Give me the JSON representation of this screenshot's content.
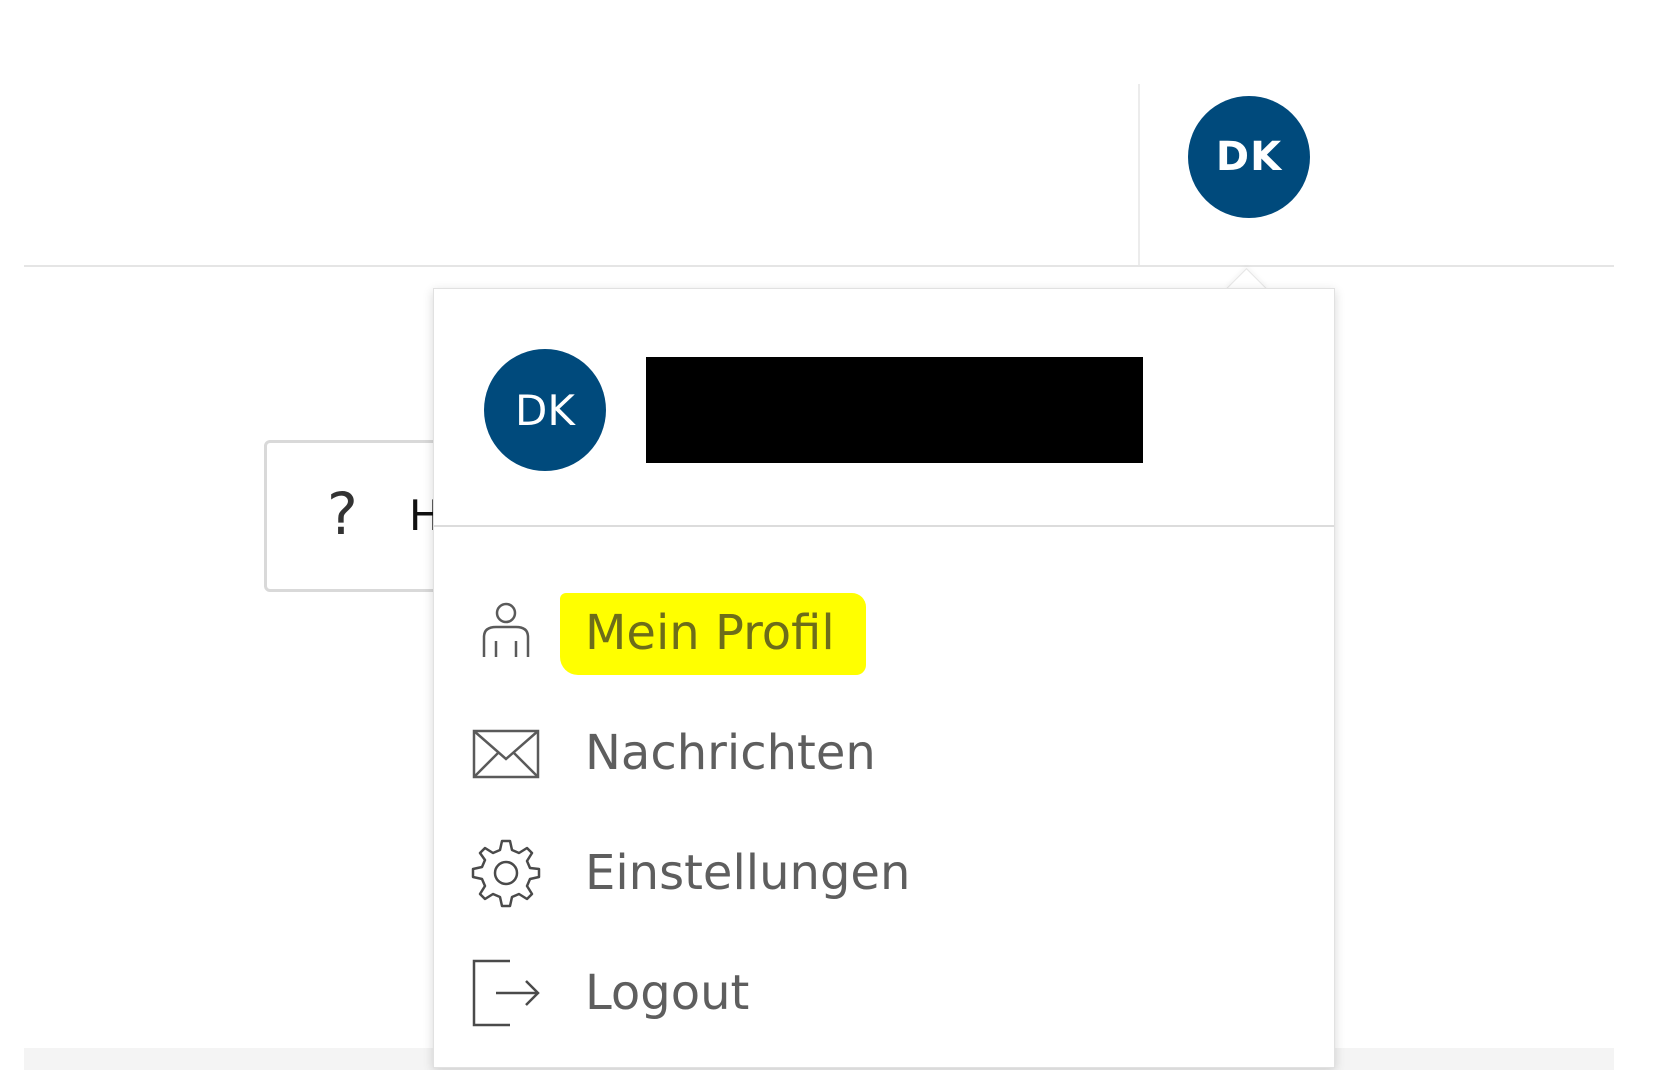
{
  "theme": {
    "avatar_color": "#004a7c",
    "highlight_color": "#ffff00",
    "menu_text_color": "#5e5e5e"
  },
  "header": {
    "user_initials": "DK"
  },
  "background_card": {
    "icon": "question-mark-icon",
    "question_glyph": "?",
    "label_fragment": "H"
  },
  "user_menu": {
    "initials": "DK",
    "username": "",
    "items": [
      {
        "label": "Mein Profil",
        "icon": "person-icon",
        "highlighted": true
      },
      {
        "label": "Nachrichten",
        "icon": "envelope-icon",
        "highlighted": false
      },
      {
        "label": "Einstellungen",
        "icon": "gear-icon",
        "highlighted": false
      },
      {
        "label": "Logout",
        "icon": "logout-icon",
        "highlighted": false
      }
    ]
  }
}
